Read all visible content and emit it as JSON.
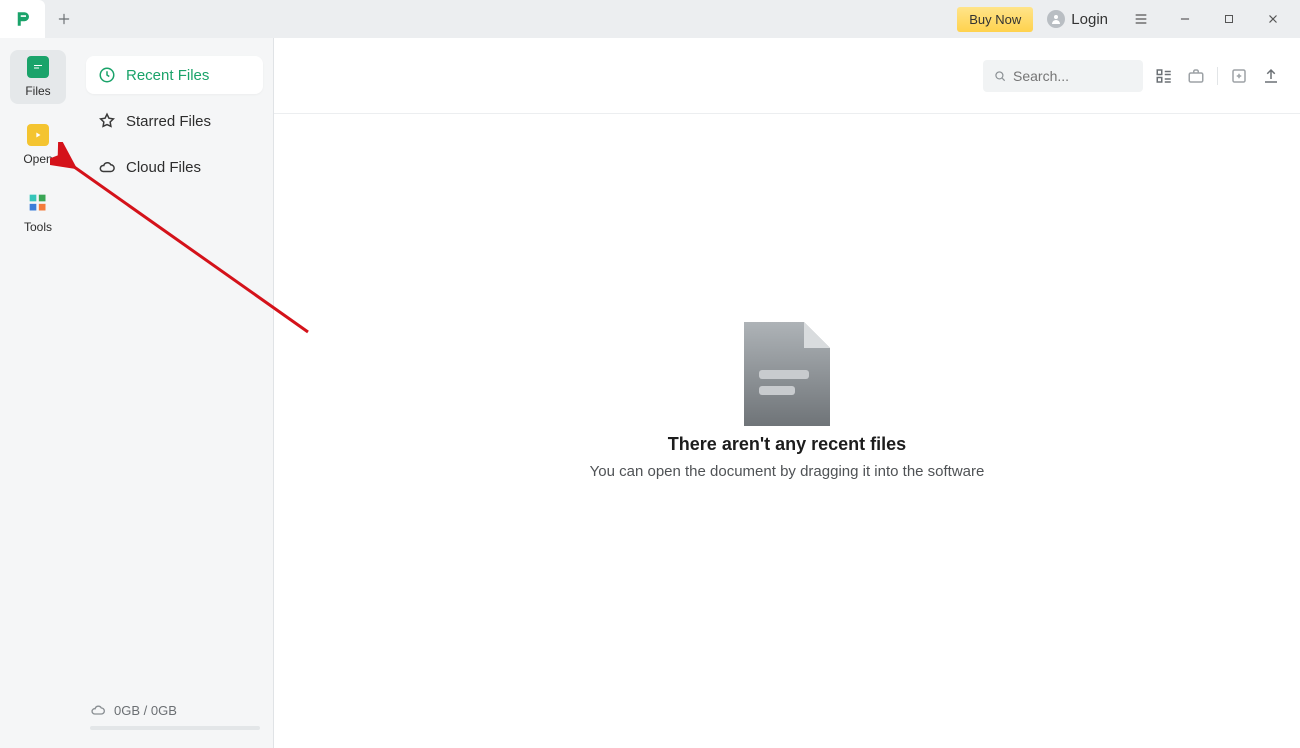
{
  "titlebar": {
    "buy_now": "Buy Now",
    "login_label": "Login"
  },
  "rail": {
    "files": "Files",
    "open": "Open",
    "tools": "Tools"
  },
  "sidebar": {
    "recent": "Recent Files",
    "starred": "Starred Files",
    "cloud": "Cloud Files",
    "storage_text": "0GB / 0GB"
  },
  "toolbar": {
    "search_placeholder": "Search..."
  },
  "empty": {
    "title": "There aren't any recent files",
    "subtitle": "You can open the document by dragging it into the software"
  },
  "colors": {
    "accent_green": "#1aa36a",
    "buy_yellow": "#ffd24d"
  }
}
